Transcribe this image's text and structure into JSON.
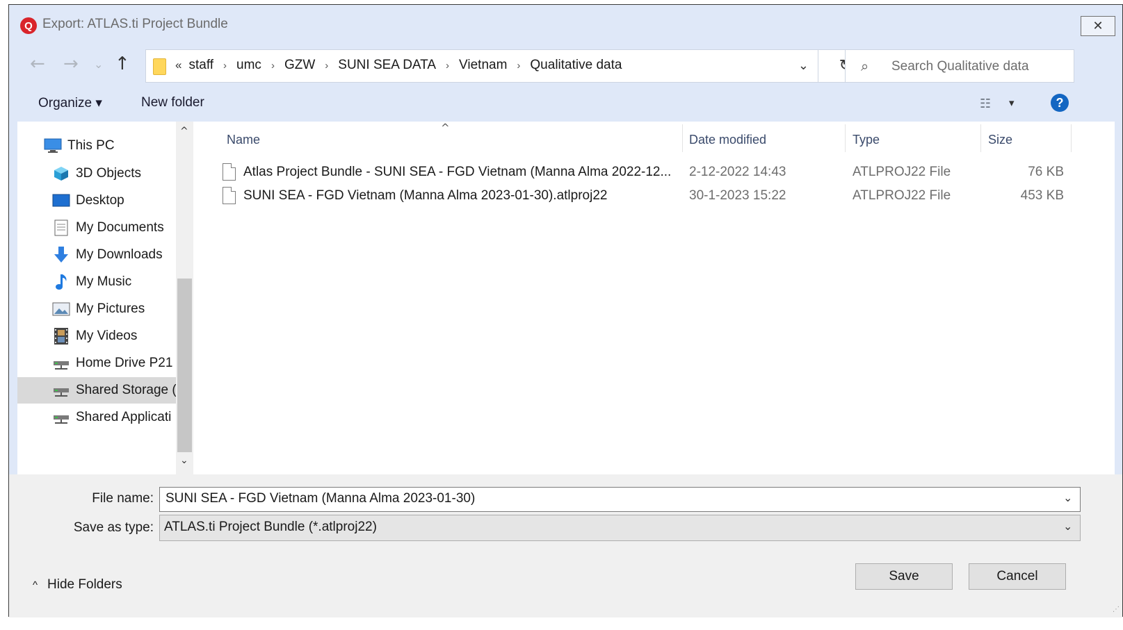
{
  "window": {
    "title": "Export: ATLAS.ti Project Bundle",
    "app_icon_glyph": "Q",
    "close_glyph": "✕"
  },
  "nav": {
    "back_glyph": "←",
    "forward_glyph": "→",
    "recent_glyph": "⌄",
    "up_glyph": "↑"
  },
  "address": {
    "overflow_glyph": "«",
    "crumbs": [
      "staff",
      "umc",
      "GZW",
      "SUNI SEA DATA",
      "Vietnam",
      "Qualitative data"
    ],
    "separator_glyph": "›",
    "dropdown_glyph": "⌄",
    "refresh_glyph": "↻"
  },
  "search": {
    "placeholder": "Search Qualitative data",
    "icon_glyph": "⌕"
  },
  "toolbar": {
    "organize_label": "Organize ▾",
    "new_folder_label": "New folder",
    "view_glyph": "☷",
    "view_dropdown_glyph": "▾",
    "help_glyph": "?"
  },
  "sidebar": {
    "items": [
      {
        "label": "This PC",
        "icon": "this-pc-icon"
      },
      {
        "label": "3D Objects",
        "icon": "3d-objects-icon"
      },
      {
        "label": "Desktop",
        "icon": "desktop-icon"
      },
      {
        "label": "My Documents",
        "icon": "documents-icon"
      },
      {
        "label": "My Downloads",
        "icon": "downloads-icon"
      },
      {
        "label": "My Music",
        "icon": "music-icon"
      },
      {
        "label": "My Pictures",
        "icon": "pictures-icon"
      },
      {
        "label": "My Videos",
        "icon": "videos-icon"
      },
      {
        "label": "Home Drive P21",
        "icon": "network-drive-icon"
      },
      {
        "label": "Shared Storage (",
        "icon": "network-drive-icon"
      },
      {
        "label": "Shared Applicati",
        "icon": "network-drive-icon"
      }
    ],
    "selected_index": 9,
    "scroll_up_glyph": "^",
    "scroll_down_glyph": "⌄"
  },
  "files": {
    "sort_glyph": "^",
    "columns": [
      "Name",
      "Date modified",
      "Type",
      "Size"
    ],
    "rows": [
      {
        "name": "Atlas Project Bundle - SUNI SEA - FGD Vietnam (Manna Alma 2022-12...",
        "date": "2-12-2022 14:43",
        "type": "ATLPROJ22 File",
        "size": "76 KB"
      },
      {
        "name": "SUNI SEA - FGD Vietnam (Manna Alma 2023-01-30).atlproj22",
        "date": "30-1-2023 15:22",
        "type": "ATLPROJ22 File",
        "size": "453 KB"
      }
    ]
  },
  "form": {
    "file_name_label": "File name:",
    "file_name_value": "SUNI SEA - FGD Vietnam (Manna Alma 2023-01-30)",
    "save_as_type_label": "Save as type:",
    "save_as_type_value": "ATLAS.ti Project Bundle (*.atlproj22)",
    "dropdown_glyph": "⌄"
  },
  "footer": {
    "hide_folders_glyph": "^",
    "hide_folders_label": "Hide Folders",
    "save_label": "Save",
    "cancel_label": "Cancel"
  },
  "colors": {
    "window_bg": "#dfe8f8",
    "selection": "#d9d9d9",
    "help": "#1366c2",
    "app_icon": "#d9242b"
  }
}
